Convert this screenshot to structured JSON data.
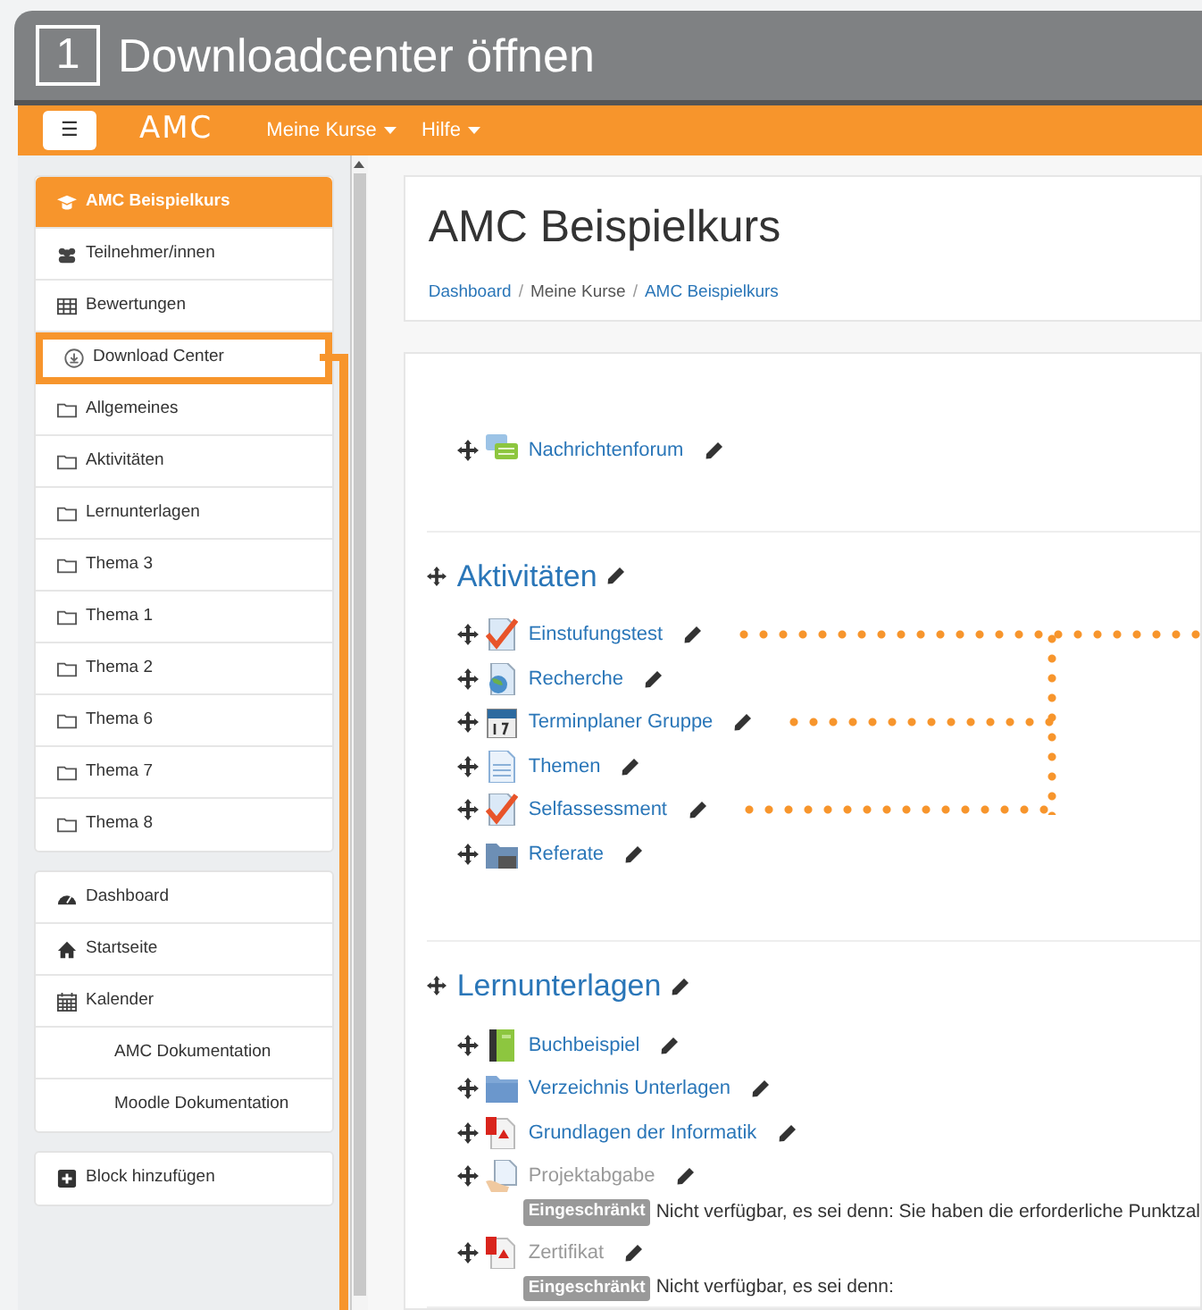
{
  "step": {
    "number": "1",
    "title": "Downloadcenter öffnen"
  },
  "navbar": {
    "menu_icon": "☰",
    "logo": "AMC",
    "menus": [
      {
        "label": "Meine Kurse"
      },
      {
        "label": "Hilfe"
      }
    ]
  },
  "sidebar": {
    "blocks": [
      {
        "items": [
          {
            "label": "AMC Beispielkurs",
            "kind": "course",
            "selected": true,
            "highlighted": false
          },
          {
            "label": "Teilnehmer/innen",
            "kind": "users",
            "selected": false,
            "highlighted": false
          },
          {
            "label": "Bewertungen",
            "kind": "table",
            "selected": false,
            "highlighted": false
          },
          {
            "label": "Download Center",
            "kind": "download",
            "selected": false,
            "highlighted": true
          },
          {
            "label": "Allgemeines",
            "kind": "folder",
            "selected": false,
            "highlighted": false
          },
          {
            "label": "Aktivitäten",
            "kind": "folder",
            "selected": false,
            "highlighted": false
          },
          {
            "label": "Lernunterlagen",
            "kind": "folder",
            "selected": false,
            "highlighted": false
          },
          {
            "label": "Thema 3",
            "kind": "folder",
            "selected": false,
            "highlighted": false
          },
          {
            "label": "Thema 1",
            "kind": "folder",
            "selected": false,
            "highlighted": false
          },
          {
            "label": "Thema 2",
            "kind": "folder",
            "selected": false,
            "highlighted": false
          },
          {
            "label": "Thema 6",
            "kind": "folder",
            "selected": false,
            "highlighted": false
          },
          {
            "label": "Thema 7",
            "kind": "folder",
            "selected": false,
            "highlighted": false
          },
          {
            "label": "Thema 8",
            "kind": "folder",
            "selected": false,
            "highlighted": false
          }
        ]
      },
      {
        "items": [
          {
            "label": "Dashboard",
            "kind": "dashboard",
            "selected": false,
            "highlighted": false
          },
          {
            "label": "Startseite",
            "kind": "home",
            "selected": false,
            "highlighted": false
          },
          {
            "label": "Kalender",
            "kind": "calendar",
            "selected": false,
            "highlighted": false
          },
          {
            "label": "AMC Dokumentation",
            "kind": "text",
            "selected": false,
            "highlighted": false
          },
          {
            "label": "Moodle Dokumentation",
            "kind": "text",
            "selected": false,
            "highlighted": false
          }
        ]
      },
      {
        "items": [
          {
            "label": "Block hinzufügen",
            "kind": "add",
            "selected": false,
            "highlighted": false
          }
        ]
      }
    ]
  },
  "header": {
    "title": "AMC Beispielkurs",
    "breadcrumb": [
      {
        "label": "Dashboard",
        "link": true
      },
      {
        "separator": "/",
        "label": "Meine Kurse",
        "link": false
      },
      {
        "separator": "/",
        "label": "AMC Beispielkurs",
        "link": true
      }
    ]
  },
  "sections": [
    {
      "activities": [
        {
          "name": "Nachrichtenforum",
          "kind": "forum",
          "restricted": false,
          "marked": false
        }
      ]
    },
    {
      "title": "Aktivitäten",
      "activities": [
        {
          "name": "Einstufungstest",
          "kind": "quiz",
          "restricted": false,
          "marked": true
        },
        {
          "name": "Recherche",
          "kind": "url",
          "restricted": false,
          "marked": false
        },
        {
          "name": "Terminplaner Gruppe",
          "kind": "scheduler",
          "restricted": false,
          "marked": true
        },
        {
          "name": "Themen",
          "kind": "page",
          "restricted": false,
          "marked": false
        },
        {
          "name": "Selfassessment",
          "kind": "quiz",
          "restricted": false,
          "marked": true
        },
        {
          "name": "Referate",
          "kind": "database",
          "restricted": false,
          "marked": false
        }
      ]
    },
    {
      "title": "Lernunterlagen",
      "activities": [
        {
          "name": "Buchbeispiel",
          "kind": "book",
          "restricted": false,
          "marked": false
        },
        {
          "name": "Verzeichnis Unterlagen",
          "kind": "folder",
          "restricted": false,
          "marked": false
        },
        {
          "name": "Grundlagen der Informatik",
          "kind": "pdf",
          "restricted": false,
          "marked": false
        },
        {
          "name": "Projektabgabe",
          "kind": "assign",
          "restricted": true,
          "marked": false,
          "badge": "Eingeschränkt",
          "note": "Nicht verfügbar, es sei denn: Sie haben die erforderliche Punktzal"
        },
        {
          "name": "Zertifikat",
          "kind": "pdf",
          "restricted": true,
          "marked": false,
          "badge": "Eingeschränkt",
          "note": "Nicht verfügbar, es sei denn:"
        }
      ]
    }
  ]
}
